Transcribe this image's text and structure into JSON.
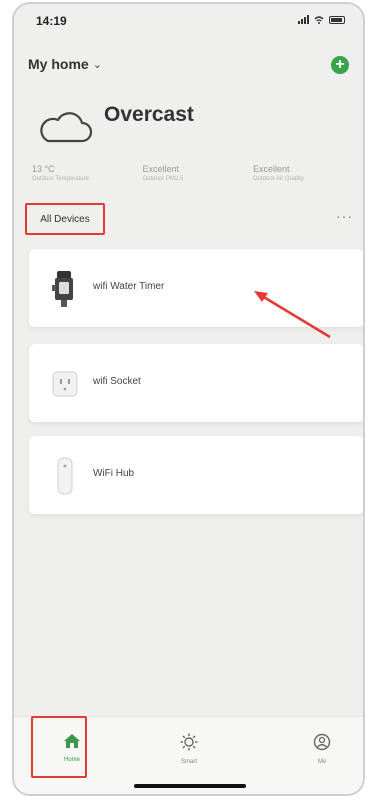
{
  "status_bar": {
    "time": "14:19"
  },
  "header": {
    "home_name": "My home",
    "add_icon": "plus-circle-icon",
    "accent_color": "#3aa44a"
  },
  "weather": {
    "condition": "Overcast",
    "icon": "cloud-icon"
  },
  "stats": [
    {
      "value": "13 °C",
      "label": "Outdoor Temperature"
    },
    {
      "value": "Excellent",
      "label": "Outdoor PM2.5"
    },
    {
      "value": "Excellent",
      "label": "Outdoor Air Quality"
    }
  ],
  "section": {
    "title": "All Devices",
    "more": "···"
  },
  "devices": [
    {
      "name": "wifi Water Timer",
      "icon": "water-timer-icon"
    },
    {
      "name": "wifi Socket",
      "icon": "socket-icon"
    },
    {
      "name": "WiFi Hub",
      "icon": "hub-icon"
    }
  ],
  "tabs": [
    {
      "label": "Home",
      "icon": "home-icon",
      "active": true
    },
    {
      "label": "Smart",
      "icon": "sun-icon",
      "active": false
    },
    {
      "label": "Me",
      "icon": "user-icon",
      "active": false
    }
  ],
  "highlight_color": "#e53935"
}
